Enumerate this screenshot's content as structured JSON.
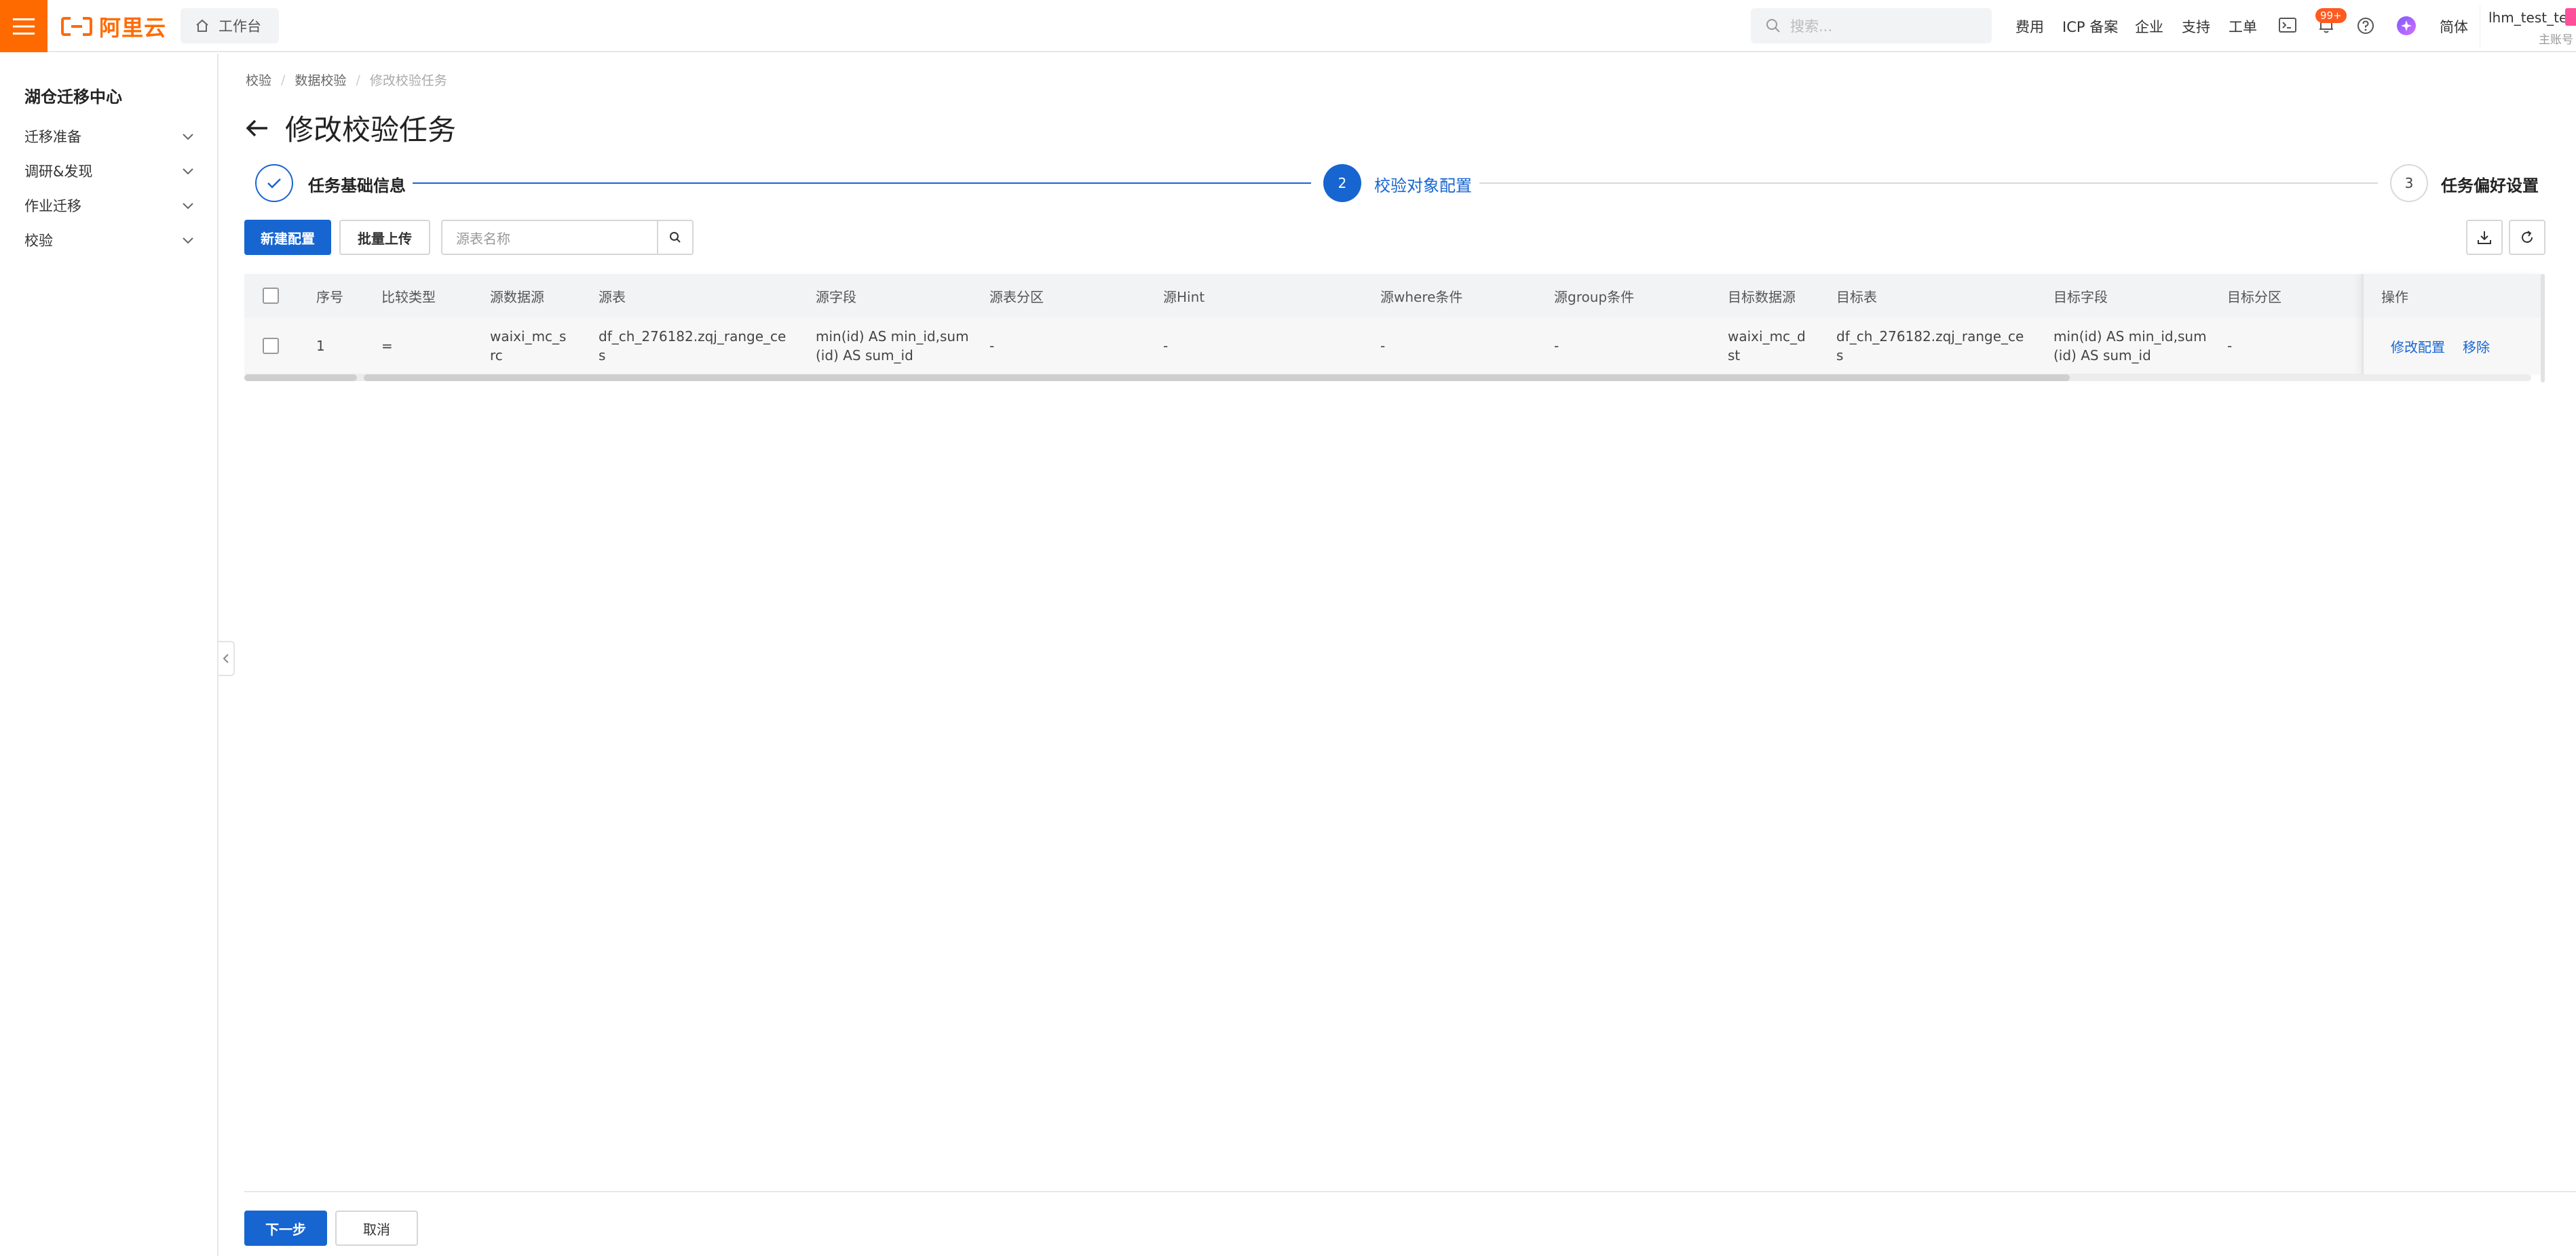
{
  "topbar": {
    "brand": "阿里云",
    "brand_color": "#ff6a00",
    "workbench_label": "工作台",
    "search_placeholder": "搜索...",
    "nav_items": [
      "费用",
      "ICP 备案",
      "企业",
      "支持",
      "工单"
    ],
    "notification_badge": "99+",
    "language": "简体",
    "user_name": "lhm_test_te",
    "user_role": "主账号"
  },
  "sidebar": {
    "title": "湖仓迁移中心",
    "items": [
      {
        "label": "迁移准备"
      },
      {
        "label": "调研&发现"
      },
      {
        "label": "作业迁移"
      },
      {
        "label": "校验"
      }
    ]
  },
  "breadcrumb": [
    "校验",
    "数据校验",
    "修改校验任务"
  ],
  "page_title": "修改校验任务",
  "steps": [
    {
      "index": "1",
      "label": "任务基础信息",
      "state": "done"
    },
    {
      "index": "2",
      "label": "校验对象配置",
      "state": "active"
    },
    {
      "index": "3",
      "label": "任务偏好设置",
      "state": "pending"
    }
  ],
  "toolbar": {
    "new_config": "新建配置",
    "batch_upload": "批量上传",
    "search_placeholder": "源表名称"
  },
  "table": {
    "columns": [
      "序号",
      "比较类型",
      "源数据源",
      "源表",
      "源字段",
      "源表分区",
      "源Hint",
      "源where条件",
      "源group条件",
      "目标数据源",
      "目标表",
      "目标字段",
      "目标分区",
      "操作"
    ],
    "rows": [
      {
        "index": "1",
        "compare_type": "=",
        "src_ds": [
          "waixi_mc_s",
          "rc"
        ],
        "src_table": [
          "df_ch_276182.zqj_range_ce",
          "s"
        ],
        "src_fields": [
          "min(id) AS min_id,sum",
          "(id) AS sum_id"
        ],
        "src_partition": "-",
        "src_hint": "-",
        "src_where": "-",
        "src_group": "-",
        "dst_ds": [
          "waixi_mc_d",
          "st"
        ],
        "dst_table": [
          "df_ch_276182.zqj_range_ce",
          "s"
        ],
        "dst_fields": [
          "min(id) AS min_id,sum",
          "(id) AS sum_id"
        ],
        "dst_partition": "-",
        "actions": [
          "修改配置",
          "移除"
        ]
      }
    ]
  },
  "footer": {
    "next": "下一步",
    "cancel": "取消"
  },
  "colors": {
    "primary": "#1765d0",
    "accent": "#ff6a00"
  }
}
